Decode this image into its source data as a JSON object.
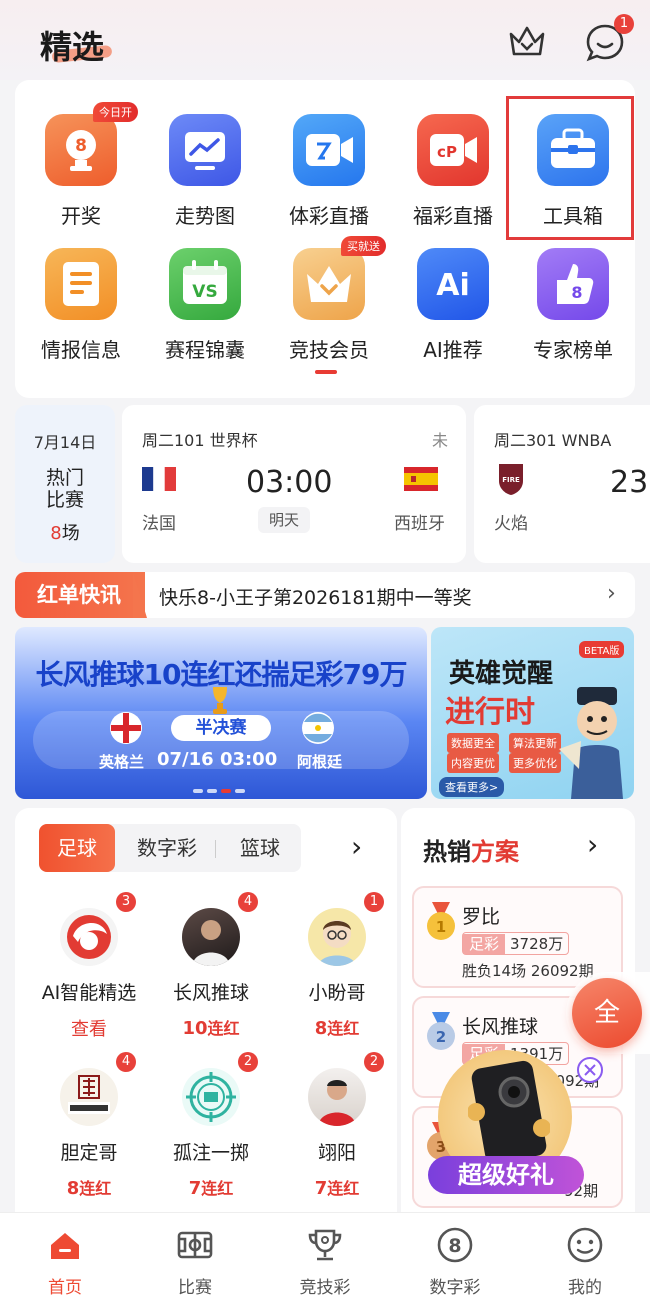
{
  "header": {
    "title": "精选",
    "message_count": "1"
  },
  "grid": {
    "row1": [
      {
        "label": "开奖",
        "badge": "今日开",
        "icon": "trophy-8-icon",
        "color": "#f2793c"
      },
      {
        "label": "走势图",
        "icon": "chart-trend-icon",
        "color": "#4a6cf0"
      },
      {
        "label": "体彩直播",
        "icon": "live-video-icon",
        "color": "#2d8ef5"
      },
      {
        "label": "福彩直播",
        "icon": "live-video-red-icon",
        "color": "#ee4a3a"
      },
      {
        "label": "工具箱",
        "icon": "toolbox-icon",
        "color": "#3a8bf2"
      }
    ],
    "row2": [
      {
        "label": "情报信息",
        "icon": "document-icon",
        "color": "#f3a13a"
      },
      {
        "label": "赛程锦囊",
        "badge": "",
        "icon": "calendar-vs-icon",
        "color": "#4cbf52"
      },
      {
        "label": "竞技会员",
        "badge": "买就送",
        "icon": "crown-vip-icon",
        "color": "#f2b458"
      },
      {
        "label": "AI推荐",
        "icon": "ai-icon",
        "color": "#2d6ff2"
      },
      {
        "label": "专家榜单",
        "icon": "thumbs-up-8-icon",
        "color": "#8a5cf0"
      }
    ]
  },
  "matches": {
    "date": {
      "date": "7月14日",
      "label1": "热门",
      "label2": "比赛",
      "count": "8",
      "unit": "场"
    },
    "m1": {
      "league": "周二101 世界杯",
      "status": "未",
      "time": "03:00",
      "day": "明天",
      "home": "法国",
      "away": "西班牙"
    },
    "m2": {
      "league": "周二301 WNBA",
      "time": "23",
      "home": "火焰"
    }
  },
  "news": {
    "tag": "红单快讯",
    "text": "快乐8-小王子第2026181期中一等奖"
  },
  "banner": {
    "headline": "长风推球10连红还揣足彩79万",
    "stage": "半决赛",
    "team_a": "英格兰",
    "team_b": "阿根廷",
    "datetime": "07/16 03:00",
    "side_title1": "英雄觉醒",
    "side_title2": "进行时",
    "side_tags": [
      "数据更全",
      "算法更新",
      "内容更优",
      "更多优化"
    ],
    "side_beta": "BETA版",
    "side_more": "查看更多>"
  },
  "tabs": [
    "足球",
    "数字彩",
    "篮球"
  ],
  "experts": [
    {
      "name": "AI智能精选",
      "badge": "3",
      "stat": "查看",
      "stat2": ""
    },
    {
      "name": "长风推球",
      "badge": "4",
      "stat": "10",
      "stat2": "连红"
    },
    {
      "name": "小盼哥",
      "badge": "1",
      "stat": "8",
      "stat2": "连红"
    },
    {
      "name": "胆定哥",
      "badge": "4",
      "stat": "8",
      "stat2": "连红"
    },
    {
      "name": "孤注一掷",
      "badge": "2",
      "stat": "7",
      "stat2": "连红"
    },
    {
      "name": "翊阳",
      "badge": "2",
      "stat": "7",
      "stat2": "连红"
    }
  ],
  "hot": {
    "title_a": "热销",
    "title_b": "方案",
    "items": [
      {
        "rank": "1",
        "name": "罗比",
        "tag": "足彩",
        "amount": "3728万",
        "desc": "胜负14场 26092期"
      },
      {
        "rank": "2",
        "name": "长风推球",
        "tag": "足彩",
        "amount": "1391万",
        "desc": "6092期"
      },
      {
        "rank": "3",
        "desc": "92期"
      }
    ]
  },
  "fab": {
    "label": "全"
  },
  "promo": {
    "label": "超级好礼"
  },
  "nav": [
    {
      "label": "首页",
      "icon": "home-icon",
      "active": true
    },
    {
      "label": "比赛",
      "icon": "stadium-icon"
    },
    {
      "label": "竞技彩",
      "icon": "trophy-icon"
    },
    {
      "label": "数字彩",
      "icon": "number-8-icon"
    },
    {
      "label": "我的",
      "icon": "smile-icon"
    }
  ],
  "colors": {
    "accent": "#ee4a33",
    "highlight": "#e23b3b"
  }
}
